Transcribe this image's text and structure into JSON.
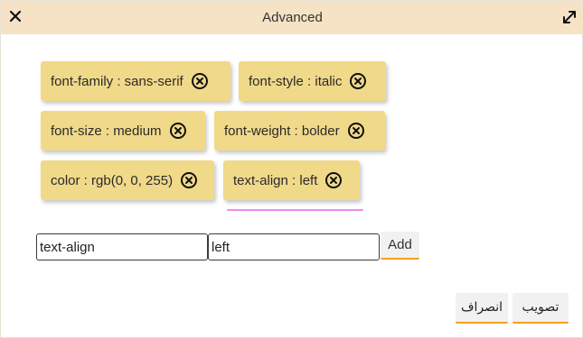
{
  "dialog": {
    "title": "Advanced"
  },
  "icons": {
    "close": "close-icon",
    "expand": "expand-icon",
    "remove": "remove-circle-icon"
  },
  "chips": [
    {
      "label": "font-family : sans-serif"
    },
    {
      "label": "font-style : italic"
    },
    {
      "label": "font-size : medium"
    },
    {
      "label": "font-weight : bolder"
    },
    {
      "label": "color : rgb(0, 0, 255)"
    },
    {
      "label": "text-align : left"
    }
  ],
  "form": {
    "property_value": "text-align",
    "value_value": "left",
    "add_label": "Add"
  },
  "footer": {
    "cancel_label": "انصراف",
    "confirm_label": "تصویب"
  },
  "colors": {
    "titlebar": "#f6e2c5",
    "chip": "#f1d98a",
    "accent": "#f0a020",
    "selected_underline": "#f08af0"
  }
}
